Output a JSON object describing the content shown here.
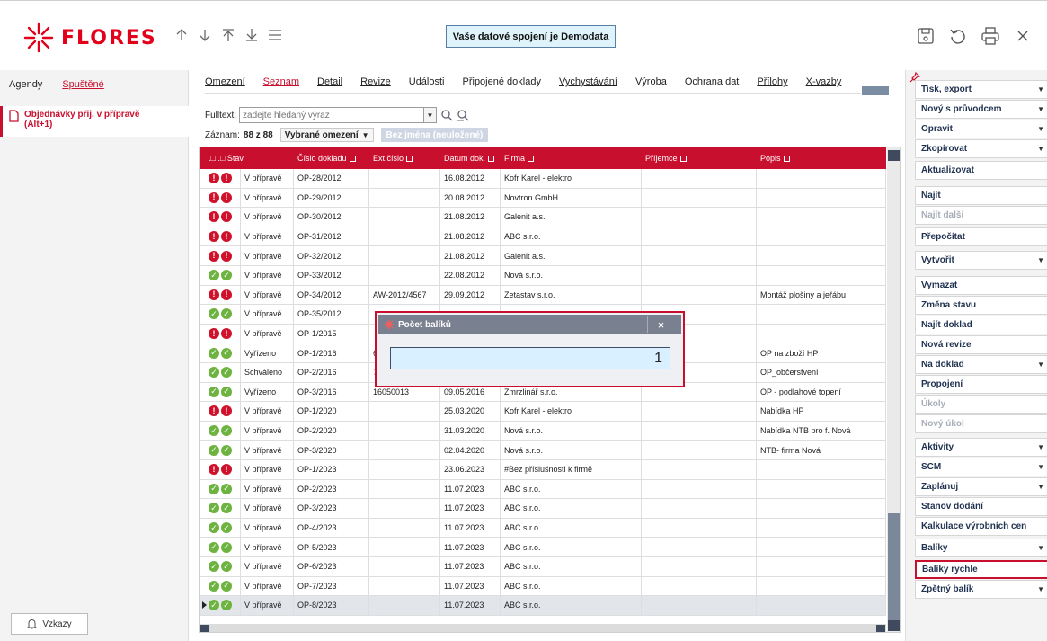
{
  "app": {
    "logo_text": "FLORES",
    "connection": "Vaše datové spojení je Demodata",
    "nav_icons": [
      "arrow-up-icon",
      "arrow-down-icon",
      "arrow-top-icon",
      "arrow-bottom-icon",
      "menu-icon"
    ],
    "right_icons": [
      "save-icon",
      "refresh-icon",
      "print-icon",
      "close-icon"
    ]
  },
  "left": {
    "tabs": [
      "Agendy",
      "Spuštěné"
    ],
    "active_tab": "Spuštěné",
    "item_line1": "Objednávky přij. v přípravě",
    "item_line2": "(Alt+1)",
    "vzkazy": "Vzkazy"
  },
  "tabs": [
    {
      "label": "Omezení",
      "underline": true
    },
    {
      "label": "Seznam",
      "active": true
    },
    {
      "label": "Detail",
      "underline": true
    },
    {
      "label": "Revize",
      "underline": true
    },
    {
      "label": "Události"
    },
    {
      "label": "Připojené doklady"
    },
    {
      "label": "Vychystávání",
      "underline": true
    },
    {
      "label": "Výroba"
    },
    {
      "label": "Ochrana dat"
    },
    {
      "label": "Přílohy",
      "underline": true
    },
    {
      "label": "X-vazby",
      "underline": true
    }
  ],
  "search": {
    "label": "Fulltext:",
    "placeholder": "zadejte hledaný výraz"
  },
  "records": {
    "label": "Záznam:",
    "value": "88 z 88",
    "filter": "Vybrané omezení",
    "filter_extra": "Bez jména (neuložené)"
  },
  "table": {
    "columns": [
      ".□ .□ Stav",
      "Číslo dokladu",
      "Ext.číslo",
      "Datum dok.",
      "Firma",
      "Příjemce",
      "Popis"
    ],
    "rows": [
      {
        "status": "red",
        "stav": "V přípravě",
        "cislo": "OP-28/2012",
        "ext": "",
        "datum": "16.08.2012",
        "firma": "Kofr Karel - elektro",
        "prijemce": "",
        "popis": ""
      },
      {
        "status": "red",
        "stav": "V přípravě",
        "cislo": "OP-29/2012",
        "ext": "",
        "datum": "20.08.2012",
        "firma": "Novtron GmbH",
        "prijemce": "",
        "popis": ""
      },
      {
        "status": "red",
        "stav": "V přípravě",
        "cislo": "OP-30/2012",
        "ext": "",
        "datum": "21.08.2012",
        "firma": "Galenit a.s.",
        "prijemce": "",
        "popis": ""
      },
      {
        "status": "red",
        "stav": "V přípravě",
        "cislo": "OP-31/2012",
        "ext": "",
        "datum": "21.08.2012",
        "firma": "ABC s.r.o.",
        "prijemce": "",
        "popis": ""
      },
      {
        "status": "red",
        "stav": "V přípravě",
        "cislo": "OP-32/2012",
        "ext": "",
        "datum": "21.08.2012",
        "firma": "Galenit a.s.",
        "prijemce": "",
        "popis": ""
      },
      {
        "status": "green",
        "stav": "V přípravě",
        "cislo": "OP-33/2012",
        "ext": "",
        "datum": "22.08.2012",
        "firma": "Nová s.r.o.",
        "prijemce": "",
        "popis": ""
      },
      {
        "status": "red",
        "stav": "V přípravě",
        "cislo": "OP-34/2012",
        "ext": "AW-2012/4567",
        "datum": "29.09.2012",
        "firma": "Zetastav s.r.o.",
        "prijemce": "",
        "popis": "Montáž plošiny a jeřábu"
      },
      {
        "status": "green",
        "stav": "V přípravě",
        "cislo": "OP-35/2012",
        "ext": "",
        "datum": "",
        "firma": "",
        "prijemce": "",
        "popis": ""
      },
      {
        "status": "red",
        "stav": "V přípravě",
        "cislo": "OP-1/2015",
        "ext": "",
        "datum": "",
        "firma": "",
        "prijemce": "",
        "popis": ""
      },
      {
        "status": "green",
        "stav": "Vyřízeno",
        "cislo": "OP-1/2016",
        "ext": "6",
        "datum": "",
        "firma": "",
        "prijemce": "",
        "popis": "OP na zboží HP"
      },
      {
        "status": "green",
        "stav": "Schváleno",
        "cislo": "OP-2/2016",
        "ext": "7",
        "datum": "",
        "firma": "",
        "prijemce": "",
        "popis": "OP_občerstvení"
      },
      {
        "status": "green",
        "stav": "Vyřízeno",
        "cislo": "OP-3/2016",
        "ext": "16050013",
        "datum": "09.05.2016",
        "firma": "Zmrzlinář s.r.o.",
        "prijemce": "",
        "popis": "OP - podlahové topení"
      },
      {
        "status": "red",
        "stav": "V přípravě",
        "cislo": "OP-1/2020",
        "ext": "",
        "datum": "25.03.2020",
        "firma": "Kofr Karel - elektro",
        "prijemce": "",
        "popis": "Nabídka HP"
      },
      {
        "status": "green",
        "stav": "V přípravě",
        "cislo": "OP-2/2020",
        "ext": "",
        "datum": "31.03.2020",
        "firma": "Nová s.r.o.",
        "prijemce": "",
        "popis": "Nabídka NTB pro f. Nová"
      },
      {
        "status": "green",
        "stav": "V přípravě",
        "cislo": "OP-3/2020",
        "ext": "",
        "datum": "02.04.2020",
        "firma": "Nová s.r.o.",
        "prijemce": "",
        "popis": "NTB- firma Nová"
      },
      {
        "status": "red",
        "stav": "V přípravě",
        "cislo": "OP-1/2023",
        "ext": "",
        "datum": "23.06.2023",
        "firma": "#Bez příslušnosti k firmě",
        "prijemce": "",
        "popis": ""
      },
      {
        "status": "green",
        "stav": "V přípravě",
        "cislo": "OP-2/2023",
        "ext": "",
        "datum": "11.07.2023",
        "firma": "ABC s.r.o.",
        "prijemce": "",
        "popis": ""
      },
      {
        "status": "green",
        "stav": "V přípravě",
        "cislo": "OP-3/2023",
        "ext": "",
        "datum": "11.07.2023",
        "firma": "ABC s.r.o.",
        "prijemce": "",
        "popis": ""
      },
      {
        "status": "green",
        "stav": "V přípravě",
        "cislo": "OP-4/2023",
        "ext": "",
        "datum": "11.07.2023",
        "firma": "ABC s.r.o.",
        "prijemce": "",
        "popis": ""
      },
      {
        "status": "green",
        "stav": "V přípravě",
        "cislo": "OP-5/2023",
        "ext": "",
        "datum": "11.07.2023",
        "firma": "ABC s.r.o.",
        "prijemce": "",
        "popis": ""
      },
      {
        "status": "green",
        "stav": "V přípravě",
        "cislo": "OP-6/2023",
        "ext": "",
        "datum": "11.07.2023",
        "firma": "ABC s.r.o.",
        "prijemce": "",
        "popis": ""
      },
      {
        "status": "green",
        "stav": "V přípravě",
        "cislo": "OP-7/2023",
        "ext": "",
        "datum": "11.07.2023",
        "firma": "ABC s.r.o.",
        "prijemce": "",
        "popis": ""
      },
      {
        "status": "green",
        "stav": "V přípravě",
        "cislo": "OP-8/2023",
        "ext": "",
        "datum": "11.07.2023",
        "firma": "ABC s.r.o.",
        "prijemce": "",
        "popis": "",
        "selected": true
      }
    ]
  },
  "dialog": {
    "title": "Počet balíků",
    "close": "×",
    "value": "1"
  },
  "actions": [
    {
      "label": "Tisk, export",
      "dropdown": true
    },
    {
      "label": "Nový s průvodcem",
      "dropdown": true
    },
    {
      "label": "Opravit",
      "dropdown": true
    },
    {
      "label": "Zkopírovat",
      "dropdown": true
    },
    {
      "label": "Aktualizovat"
    },
    {
      "label": "Najít"
    },
    {
      "label": "Najít další",
      "disabled": true
    },
    {
      "label": "Přepočítat"
    },
    {
      "label": "Vytvořit",
      "dropdown": true
    },
    {
      "label": "Vymazat"
    },
    {
      "label": "Změna stavu"
    },
    {
      "label": "Najít doklad"
    },
    {
      "label": "Nová revize"
    },
    {
      "label": "Na doklad",
      "dropdown": true
    },
    {
      "label": "Propojení"
    },
    {
      "label": "Úkoly",
      "disabled": true
    },
    {
      "label": "Nový úkol",
      "disabled": true
    },
    {
      "label": "Aktivity",
      "dropdown": true
    },
    {
      "label": "SCM",
      "dropdown": true
    },
    {
      "label": "Zaplánuj",
      "dropdown": true
    },
    {
      "label": "Stanov dodání"
    },
    {
      "label": "Kalkulace výrobních cen"
    },
    {
      "label": "Balíky",
      "dropdown": true
    },
    {
      "label": "Balíky rychle",
      "highlighted": true
    },
    {
      "label": "Zpětný balík",
      "dropdown": true
    }
  ],
  "colors": {
    "brand": "#c8102e",
    "header_bg": "#c8102e",
    "status_red": "#d0112b",
    "status_green": "#6db33f",
    "connection_bg": "#dff3fb",
    "dialog_input_bg": "#d8f0ff"
  }
}
